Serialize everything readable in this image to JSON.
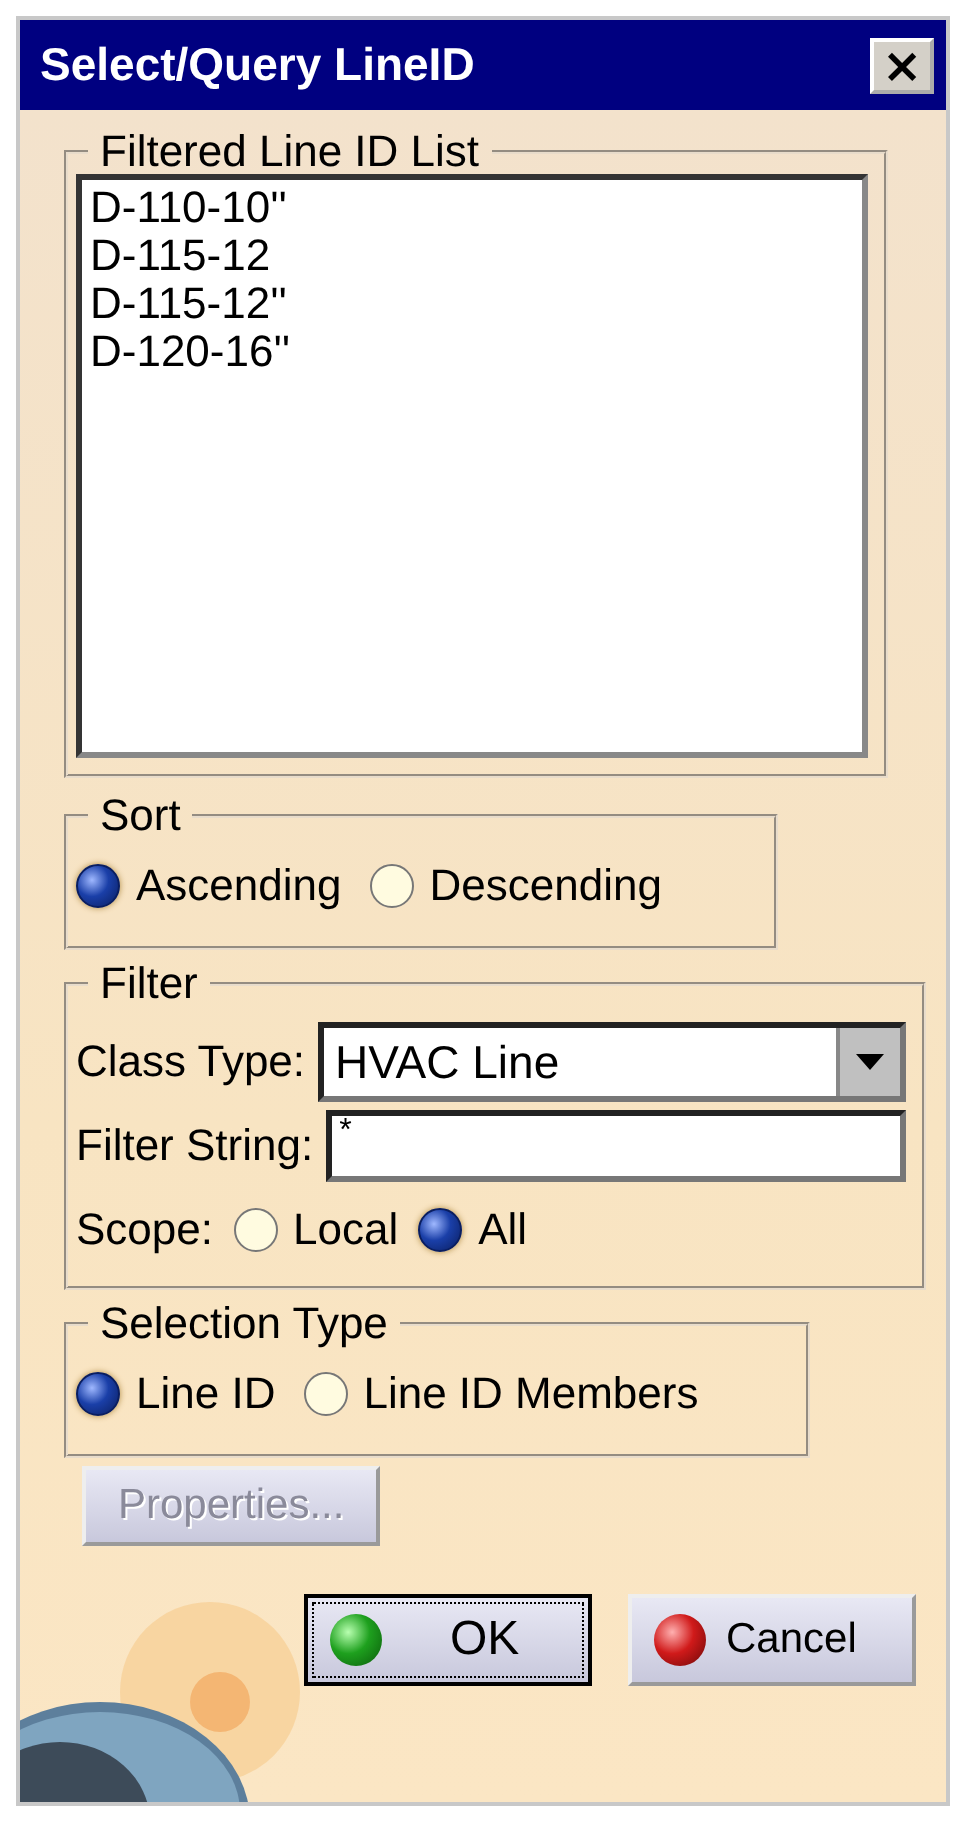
{
  "window": {
    "title": "Select/Query LineID",
    "close": "×"
  },
  "line_id_list": {
    "label": "Filtered Line ID List",
    "items": [
      "D-110-10''",
      "D-115-12",
      "D-115-12''",
      "D-120-16''"
    ]
  },
  "sort": {
    "label": "Sort",
    "options": [
      {
        "label": "Ascending",
        "selected": true
      },
      {
        "label": "Descending",
        "selected": false
      }
    ]
  },
  "filter": {
    "label": "Filter",
    "class_type": {
      "label": "Class Type:",
      "value": "HVAC Line"
    },
    "filter_string": {
      "label": "Filter String:",
      "value": "*"
    },
    "scope": {
      "label": "Scope:",
      "options": [
        {
          "label": "Local",
          "selected": false
        },
        {
          "label": "All",
          "selected": true
        }
      ]
    }
  },
  "selection_type": {
    "label": "Selection Type",
    "options": [
      {
        "label": "Line ID",
        "selected": true
      },
      {
        "label": "Line ID Members",
        "selected": false
      }
    ]
  },
  "buttons": [
    {
      "kind": "properties",
      "label": "Properties...",
      "disabled": true,
      "focused": false
    },
    {
      "kind": "ok",
      "label": "OK",
      "disabled": false,
      "focused": true
    },
    {
      "kind": "cancel",
      "label": "Cancel",
      "disabled": false,
      "focused": false
    }
  ]
}
